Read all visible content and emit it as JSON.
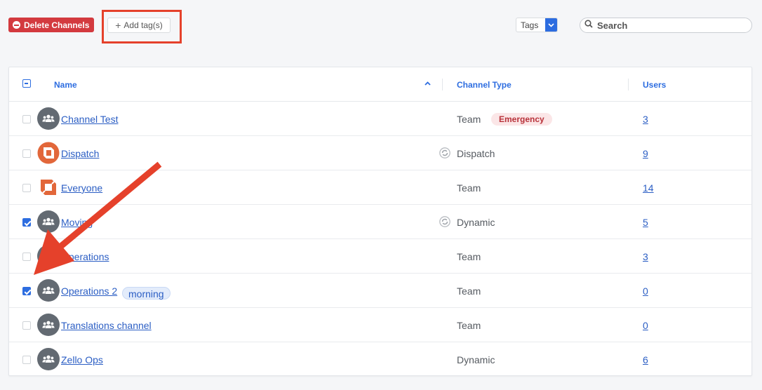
{
  "toolbar": {
    "delete_label": "Delete Channels",
    "add_tag_label": "Add tag(s)",
    "tags_filter": "Tags",
    "search_placeholder": "Search"
  },
  "table": {
    "columns": {
      "name": "Name",
      "type": "Channel Type",
      "users": "Users"
    },
    "rows": [
      {
        "name": "Channel Test",
        "type": "Team",
        "badge": "Emergency",
        "users": "3",
        "checked": false,
        "avatar": "group"
      },
      {
        "name": "Dispatch",
        "type": "Dispatch",
        "users": "9",
        "checked": false,
        "avatar": "logo",
        "sync": true
      },
      {
        "name": "Everyone",
        "type": "Team",
        "users": "14",
        "checked": false,
        "avatar": "logo"
      },
      {
        "name": "Moving",
        "type": "Dynamic",
        "users": "5",
        "checked": true,
        "avatar": "group",
        "sync": true
      },
      {
        "name": "Operations",
        "type": "Team",
        "users": "3",
        "checked": false,
        "avatar": "group"
      },
      {
        "name": "Operations 2",
        "tag": "morning",
        "type": "Team",
        "users": "0",
        "checked": true,
        "avatar": "group"
      },
      {
        "name": "Translations channel",
        "type": "Team",
        "users": "0",
        "checked": false,
        "avatar": "group"
      },
      {
        "name": "Zello Ops",
        "type": "Dynamic",
        "users": "6",
        "checked": false,
        "avatar": "group"
      }
    ]
  },
  "colors": {
    "accent": "#2d6de0",
    "danger": "#d33a3f",
    "annotation": "#e5412b",
    "logo": "#e2673a"
  }
}
